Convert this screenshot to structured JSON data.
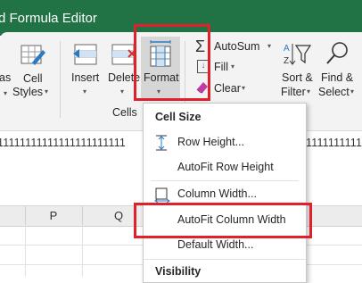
{
  "title_bar": {
    "text": "d Formula Editor",
    "color": "#217346"
  },
  "ribbon": {
    "partial_left_1": "as",
    "partial_left_2": "Cell",
    "styles_label": "Styles",
    "insert_label": "Insert",
    "delete_label": "Delete",
    "format_label": "Format",
    "cells_group_label": "Cells",
    "autosum_label": "AutoSum",
    "fill_label": "Fill",
    "clear_label": "Clear",
    "sort_label_1": "Sort &",
    "sort_label_2": "Filter",
    "find_label_1": "Find &",
    "find_label_2": "Select"
  },
  "sheet": {
    "row_text_left": "11111111111111111111111",
    "row_text_right": "11111111111",
    "column_p": "P",
    "column_q": "Q"
  },
  "format_menu": {
    "section_cell_size": "Cell Size",
    "items": [
      {
        "label": "Row Height..."
      },
      {
        "label": "AutoFit Row Height"
      },
      {
        "label": "Column Width..."
      },
      {
        "label": "AutoFit Column Width"
      },
      {
        "label": "Default Width..."
      }
    ],
    "section_visibility": "Visibility"
  },
  "highlight_color": "#e0202a",
  "accent_color": "#217346"
}
